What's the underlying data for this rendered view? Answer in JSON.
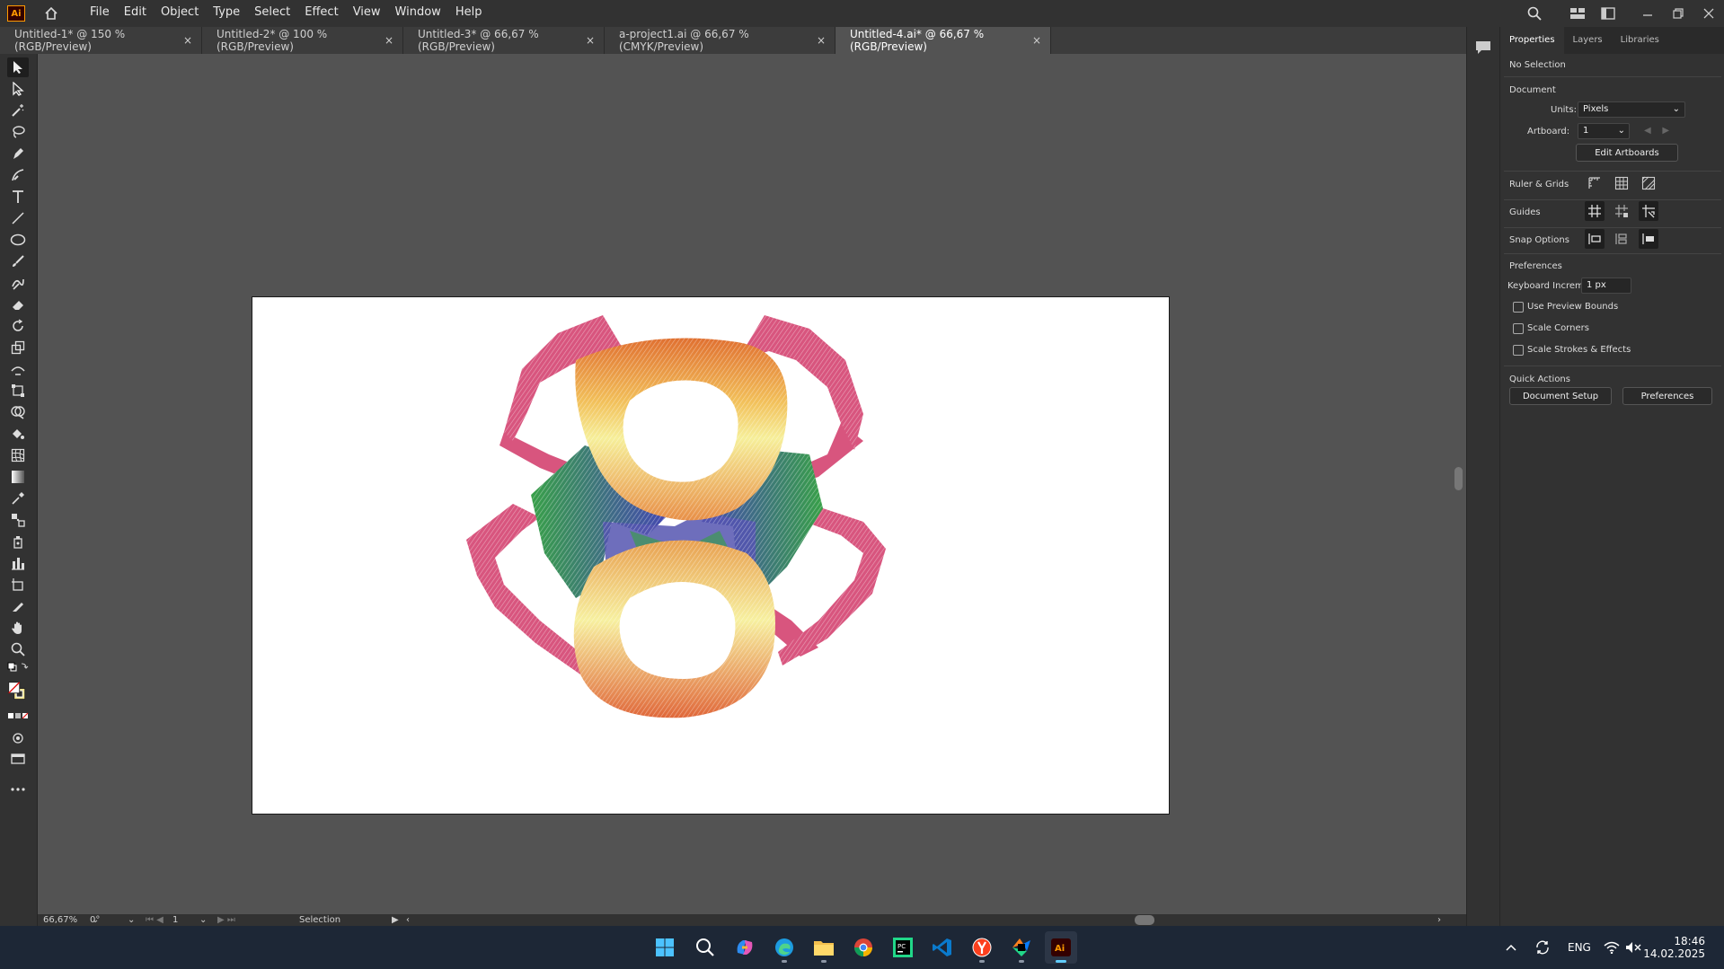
{
  "app": {
    "logo": "Ai",
    "home_icon": "home-icon"
  },
  "menu": [
    "File",
    "Edit",
    "Object",
    "Type",
    "Select",
    "Effect",
    "View",
    "Window",
    "Help"
  ],
  "tabs": [
    {
      "label": "Untitled-1* @ 150 % (RGB/Preview)",
      "close": "×"
    },
    {
      "label": "Untitled-2* @ 100 % (RGB/Preview)",
      "close": "×"
    },
    {
      "label": "Untitled-3* @ 66,67 % (RGB/Preview)",
      "close": "×"
    },
    {
      "label": "a-project1.ai @ 66,67 % (CMYK/Preview)",
      "close": "×"
    },
    {
      "label": "Untitled-4.ai* @ 66,67 % (RGB/Preview)",
      "close": "×"
    }
  ],
  "status": {
    "zoom": "66,67%",
    "rotation": "0°",
    "artboard": "1",
    "tool": "Selection"
  },
  "panel": {
    "tabs": [
      "Properties",
      "Layers",
      "Libraries"
    ],
    "selection": "No Selection",
    "document_heading": "Document",
    "units_label": "Units:",
    "units_value": "Pixels",
    "artboard_label": "Artboard:",
    "artboard_value": "1",
    "edit_artboards": "Edit Artboards",
    "ruler_grids": "Ruler & Grids",
    "guides": "Guides",
    "snap_options": "Snap Options",
    "preferences_heading": "Preferences",
    "keyboard_increment_label": "Keyboard Increment:",
    "keyboard_increment_value": "1 px",
    "use_preview_bounds": "Use Preview Bounds",
    "scale_corners": "Scale Corners",
    "scale_strokes": "Scale Strokes & Effects",
    "quick_actions": "Quick Actions",
    "document_setup": "Document Setup",
    "preferences_button": "Preferences"
  },
  "taskbar": {
    "lang": "ENG",
    "time": "18:46",
    "date": "14.02.2025"
  },
  "colors": {
    "ui_dark": "#323232",
    "canvas": "#535353",
    "accent": "#ff9a00",
    "pink": "#d9547e",
    "green": "#3a9a4a",
    "blue": "#4b4fa8",
    "orange": "#e06a3a",
    "yellow": "#f2e06a"
  }
}
